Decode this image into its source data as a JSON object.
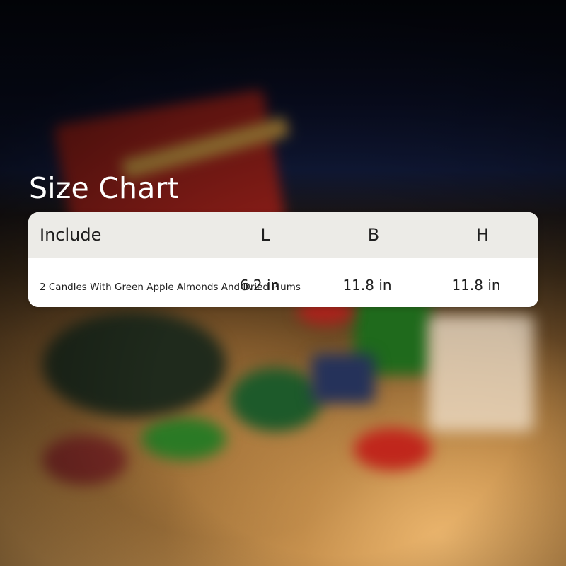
{
  "title": "Size Chart",
  "size_table": {
    "headers": [
      "Include",
      "L",
      "B",
      "H"
    ],
    "rows": [
      [
        "2 Candles With Green Apple Almonds And Dried Plums",
        "6.2 in",
        "11.8 in",
        "11.8 in"
      ]
    ]
  }
}
